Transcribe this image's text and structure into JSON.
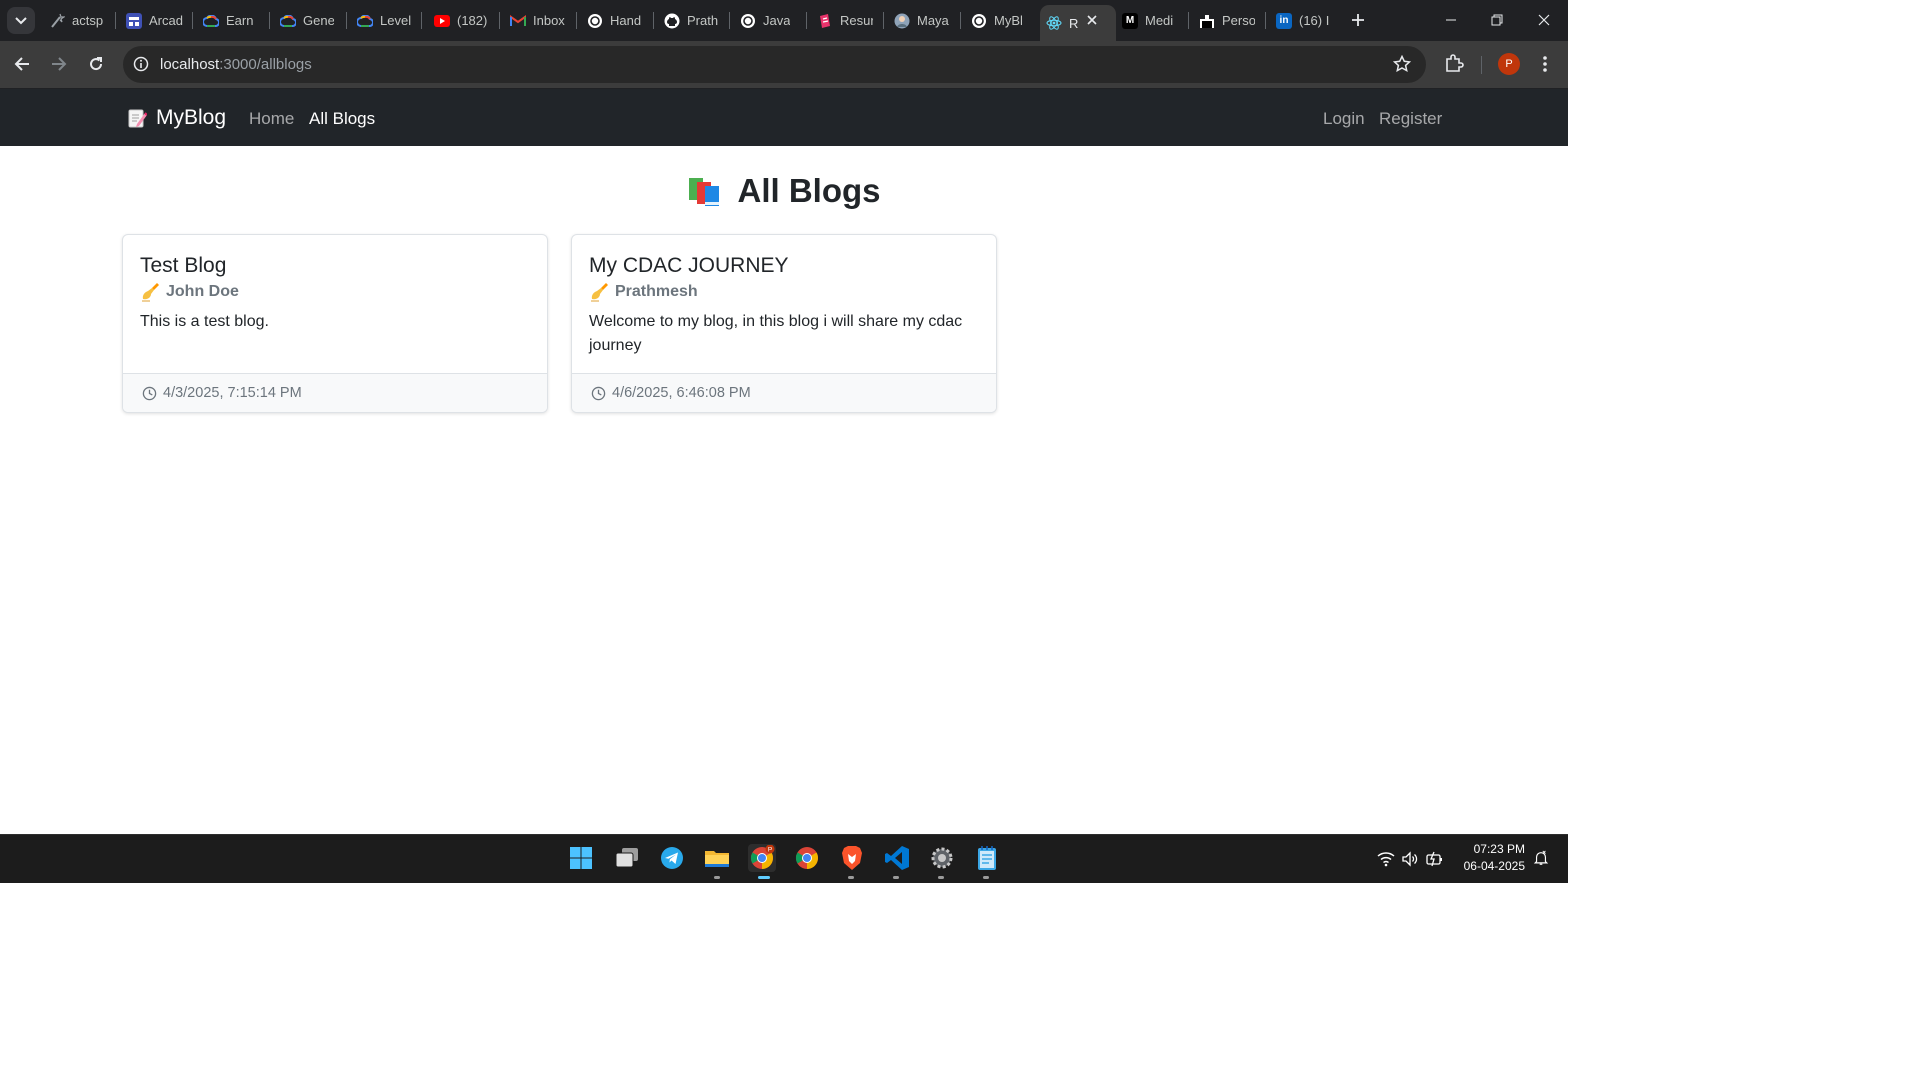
{
  "browser": {
    "tabs": [
      {
        "title": "actsp",
        "icon": "wand-icon"
      },
      {
        "title": "Arcad",
        "icon": "arcade-icon"
      },
      {
        "title": "Earn",
        "icon": "google-cloud-icon"
      },
      {
        "title": "Gene",
        "icon": "google-cloud-icon"
      },
      {
        "title": "Level",
        "icon": "google-cloud-icon"
      },
      {
        "title": "(182)",
        "icon": "youtube-icon"
      },
      {
        "title": "Inbox",
        "icon": "gmail-icon"
      },
      {
        "title": "Hand",
        "icon": "openai-icon"
      },
      {
        "title": "Prath",
        "icon": "github-icon"
      },
      {
        "title": "Java",
        "icon": "openai-icon"
      },
      {
        "title": "Resur",
        "icon": "resume-icon"
      },
      {
        "title": "Maya",
        "icon": "maya-icon"
      },
      {
        "title": "MyBl",
        "icon": "openai-icon"
      },
      {
        "title": "R",
        "icon": "react-icon",
        "active": true
      },
      {
        "title": "Medi",
        "icon": "medium-icon"
      },
      {
        "title": "Perso",
        "icon": "site-icon"
      },
      {
        "title": "(16) I",
        "icon": "linkedin-icon"
      }
    ],
    "url_host": "localhost",
    "url_path": ":3000/allblogs",
    "profile_initial": "P"
  },
  "navbar": {
    "brand": "MyBlog",
    "links": [
      {
        "label": "Home",
        "active": false
      },
      {
        "label": "All Blogs",
        "active": true
      }
    ],
    "auth": {
      "login": "Login",
      "register": "Register"
    }
  },
  "page": {
    "title": "All Blogs"
  },
  "blogs": [
    {
      "title": "Test Blog",
      "author": "John Doe",
      "content": "This is a test blog.",
      "date": "4/3/2025, 7:15:14 PM"
    },
    {
      "title": "My CDAC JOURNEY",
      "author": "Prathmesh",
      "content": "Welcome to my blog, in this blog i will share my cdac journey",
      "date": "4/6/2025, 6:46:08 PM"
    }
  ],
  "taskbar": {
    "apps": [
      "windows-start-icon",
      "task-view-icon",
      "telegram-icon",
      "file-explorer-icon",
      "chrome-profile-icon",
      "chrome-icon",
      "brave-icon",
      "vscode-icon",
      "settings-gear-icon",
      "notepad-icon"
    ],
    "time": "07:23 PM",
    "date": "06-04-2025"
  },
  "colors": {
    "navbar_bg": "#212529",
    "tabstrip_bg": "#202124",
    "toolbar_bg": "#3c3c3c",
    "taskbar_bg": "#1c1c1c",
    "text_dark": "#212529",
    "text_muted": "#6c757d"
  }
}
